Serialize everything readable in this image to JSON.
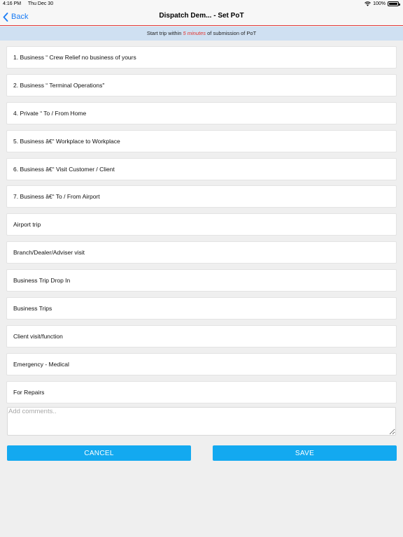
{
  "status_bar": {
    "time": "4:16 PM",
    "date": "Thu Dec 30",
    "battery_percent": "100%",
    "wifi_icon": "wifi-icon",
    "battery_icon": "battery-icon"
  },
  "nav": {
    "back_label": "Back",
    "back_icon": "chevron-left-icon",
    "title": "Dispatch Dem... - Set PoT",
    "accent_color": "#1a7cf5",
    "divider_color": "#e23b3b"
  },
  "banner": {
    "prefix": "Start trip within",
    "highlight": "5 minutes",
    "suffix": "of submission of PoT"
  },
  "purposes": [
    "1. Business “ Crew Relief no business of yours",
    "2. Business “ Terminal Operations\"",
    "4. Private “ To / From Home",
    "5. Business â€“ Workplace to Workplace",
    "6. Business â€“ Visit Customer / Client",
    "7. Business â€“ To / From Airport",
    "Airport trip",
    "Branch/Dealer/Adviser visit",
    "Business Trip Drop In",
    "Business Trips",
    "Client visit/function",
    "Emergency - Medical",
    "For Repairs"
  ],
  "comments": {
    "placeholder": "Add comments..",
    "value": ""
  },
  "actions": {
    "cancel_label": "CANCEL",
    "save_label": "SAVE",
    "button_color": "#13a9f0"
  }
}
